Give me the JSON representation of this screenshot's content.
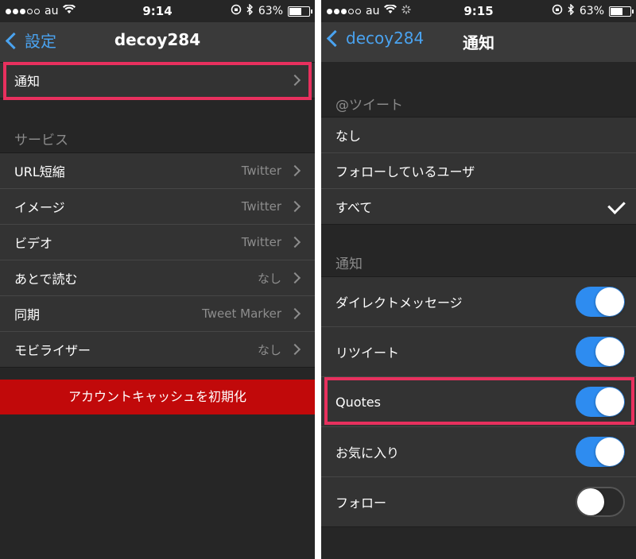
{
  "left": {
    "status": {
      "carrier": "au",
      "time": "9:14",
      "battery": "63%",
      "battery_level": 0.63
    },
    "nav": {
      "back": "設定",
      "title": "decoy284"
    },
    "notify_row": {
      "label": "通知"
    },
    "services_header": "サービス",
    "services": [
      {
        "label": "URL短縮",
        "value": "Twitter"
      },
      {
        "label": "イメージ",
        "value": "Twitter"
      },
      {
        "label": "ビデオ",
        "value": "Twitter"
      },
      {
        "label": "あとで読む",
        "value": "なし"
      },
      {
        "label": "同期",
        "value": "Tweet Marker"
      },
      {
        "label": "モビライザー",
        "value": "なし"
      }
    ],
    "reset_button": "アカウントキャッシュを初期化"
  },
  "right": {
    "status": {
      "carrier": "au",
      "time": "9:15",
      "battery": "63%",
      "battery_level": 0.63
    },
    "nav": {
      "back": "decoy284",
      "title": "通知"
    },
    "mention_header": "@ツイート",
    "mention_options": [
      {
        "label": "なし",
        "checked": false
      },
      {
        "label": "フォローしているユーザ",
        "checked": false
      },
      {
        "label": "すべて",
        "checked": true
      }
    ],
    "notify_header": "通知",
    "toggles": [
      {
        "label": "ダイレクトメッセージ",
        "on": true
      },
      {
        "label": "リツイート",
        "on": true
      },
      {
        "label": "Quotes",
        "on": true
      },
      {
        "label": "お気に入り",
        "on": true
      },
      {
        "label": "フォロー",
        "on": false
      }
    ]
  },
  "colors": {
    "accent": "#4aa3f0",
    "toggle_on": "#2e8cf0",
    "highlight": "#e8305e",
    "danger": "#c1090a"
  }
}
